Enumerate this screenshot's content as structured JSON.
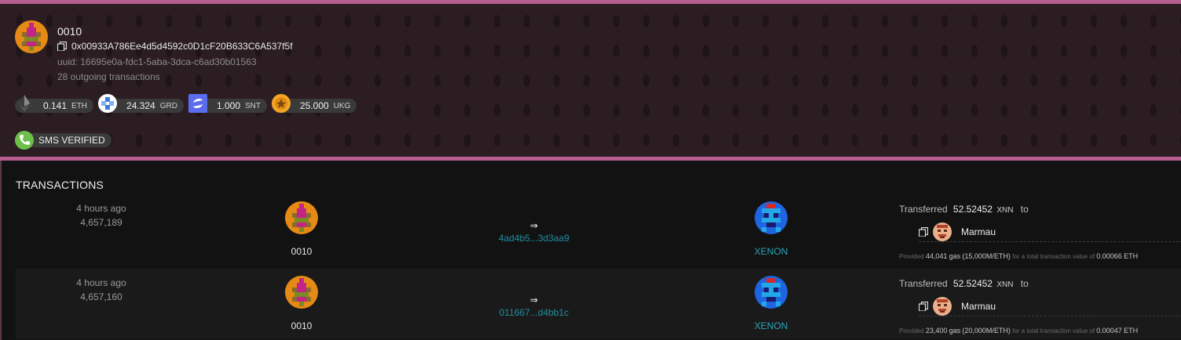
{
  "account": {
    "name": "0010",
    "address": "0x00933A786Ee4d5d4592c0D1cF20B633C6A537f5f",
    "uuid": "uuid: 16695e0a-fdc1-5aba-3dca-c6ad30b01563",
    "outgoing": "28 outgoing transactions",
    "avatar_icon": "pixel-avatar-orange-icon",
    "tokens": [
      {
        "amount": "0.141",
        "symbol": "ETH",
        "icon": "ethereum-icon",
        "color": "#3c3c3d"
      },
      {
        "amount": "24.324",
        "symbol": "GRD",
        "icon": "grd-token-icon",
        "color": "#ffffff"
      },
      {
        "amount": "1.000",
        "symbol": "SNT",
        "icon": "status-token-icon",
        "color": "#5b6dee"
      },
      {
        "amount": "25.000",
        "symbol": "UKG",
        "icon": "ukg-token-icon",
        "color": "#f5a623"
      }
    ],
    "verification": {
      "label": "SMS VERIFIED",
      "icon": "phone-icon",
      "color": "#6cc04a"
    }
  },
  "transactions": {
    "heading": "TRANSACTIONS",
    "rows": [
      {
        "time": "4 hours ago",
        "block": "4,657,189",
        "from_name": "0010",
        "arrow": "⇒",
        "hash": "4ad4b5...3d3aa9",
        "to_name": "XENON",
        "transferred_label": "Transferred",
        "value": "52.52452",
        "symbol": "XNN",
        "to_label": "to",
        "recipient": "Marmau",
        "gas_provided": "Provided",
        "gas_amount": "44,041",
        "gas_unit": "gas",
        "gas_price": "(15,000M/ETH)",
        "gas_total_label": "for a total transaction value of",
        "gas_total": "0.00066",
        "gas_total_unit": "ETH"
      },
      {
        "time": "4 hours ago",
        "block": "4,657,160",
        "from_name": "0010",
        "arrow": "⇒",
        "hash": "011667...d4bb1c",
        "to_name": "XENON",
        "transferred_label": "Transferred",
        "value": "52.52452",
        "symbol": "XNN",
        "to_label": "to",
        "recipient": "Marmau",
        "gas_provided": "Provided",
        "gas_amount": "23,400",
        "gas_unit": "gas",
        "gas_price": "(20,000M/ETH)",
        "gas_total_label": "for a total transaction value of",
        "gas_total": "0.00047",
        "gas_total_unit": "ETH"
      }
    ]
  },
  "colors": {
    "accent_pink": "#b45d8e",
    "link_teal": "#1f8ea3",
    "header_bg": "#2b1d22"
  }
}
